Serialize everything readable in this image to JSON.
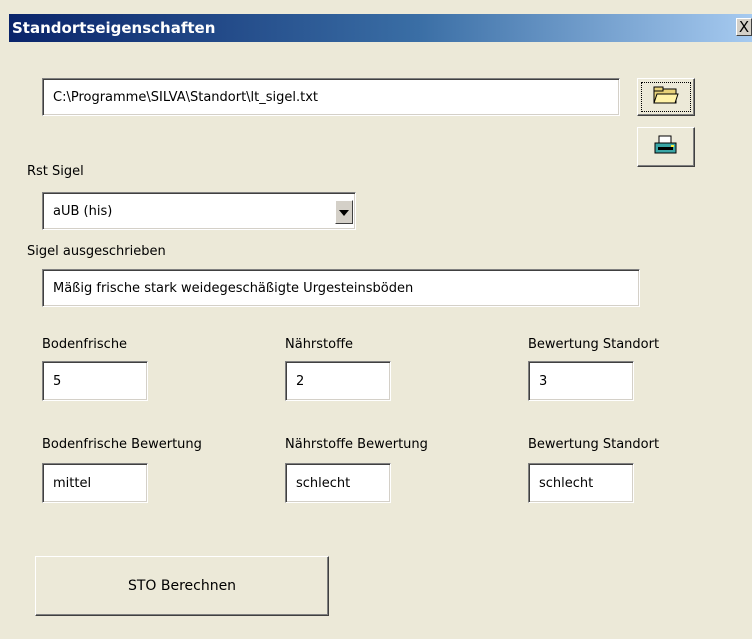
{
  "window": {
    "title": "Standortseigenschaften",
    "close_label": "X"
  },
  "file": {
    "path": "C:\\Programme\\SILVA\\Standort\\lt_sigel.txt"
  },
  "icons": {
    "open_folder": "open-folder-icon",
    "print": "print-icon"
  },
  "rst_sigel": {
    "label": "Rst Sigel",
    "value": "aUB (his)"
  },
  "sigel_ausgeschrieben": {
    "label": "Sigel ausgeschrieben",
    "value": "Mäßig frische stark weidegeschäßigte Urgesteinsböden"
  },
  "values_row": [
    {
      "label": "Bodenfrische",
      "value": "5"
    },
    {
      "label": "Nährstoffe",
      "value": "2"
    },
    {
      "label": "Bewertung Standort",
      "value": "3"
    }
  ],
  "rating_row": [
    {
      "label": "Bodenfrische Bewertung",
      "value": "mittel"
    },
    {
      "label": "Nährstoffe Bewertung",
      "value": "schlecht"
    },
    {
      "label": "Bewertung Standort",
      "value": "schlecht"
    }
  ],
  "actions": {
    "calculate_label": "STO Berechnen"
  },
  "colors": {
    "title_gradient_start": "#0a246a",
    "title_gradient_end": "#a6caf0",
    "face": "#ece9d8"
  }
}
